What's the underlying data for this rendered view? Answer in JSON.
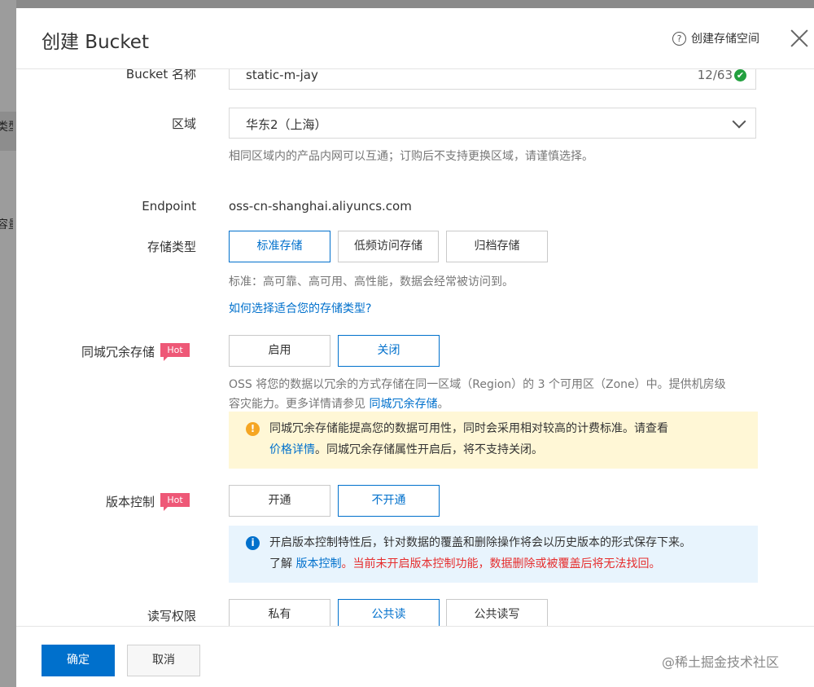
{
  "background": {
    "fragments": [
      "类型",
      "容量"
    ]
  },
  "dialog": {
    "title": "创建 Bucket",
    "help_label": "创建存储空间",
    "help_icon": "?",
    "close_icon": "close-icon"
  },
  "form": {
    "name": {
      "label": "Bucket 名称",
      "value": "static-m-jay",
      "count": "12/63",
      "valid_icon": "✔"
    },
    "region": {
      "label": "区域",
      "value": "华东2（上海）",
      "hint": "相同区域内的产品内网可以互通；订购后不支持更换区域，请谨慎选择。"
    },
    "endpoint": {
      "label": "Endpoint",
      "value": "oss-cn-shanghai.aliyuncs.com"
    },
    "storage_type": {
      "label": "存储类型",
      "options": [
        "标准存储",
        "低频访问存储",
        "归档存储"
      ],
      "selected": "标准存储",
      "hint": "标准：高可靠、高可用、高性能，数据会经常被访问到。",
      "link": "如何选择适合您的存储类型?"
    },
    "zone_redundancy": {
      "label": "同城冗余存储",
      "badge": "Hot",
      "options": [
        "启用",
        "关闭"
      ],
      "selected": "关闭",
      "desc_line1": "OSS 将您的数据以冗余的方式存储在同一区域（Region）的 3 个可用区（Zone）中。提供机房级",
      "desc_line2": "容灾能力。更多详情请参见",
      "desc_link": "同城冗余存储",
      "desc_end": "。",
      "warning_icon": "!",
      "warning_line1": "同城冗余存储能提高您的数据可用性，同时会采用相对较高的计费标准。请查看",
      "warning_link": "价格详情",
      "warning_line2": "。同城冗余存储属性开启后，将不支持关闭。"
    },
    "versioning": {
      "label": "版本控制",
      "badge": "Hot",
      "options": [
        "开通",
        "不开通"
      ],
      "selected": "不开通",
      "info_icon": "i",
      "info_line1": "开启版本控制特性后，针对数据的覆盖和删除操作将会以历史版本的形式保存下来。",
      "info_prefix": "了解",
      "info_link": "版本控制",
      "info_warning": "。当前未开启版本控制功能，数据删除或被覆盖后将无法找回。"
    },
    "acl": {
      "label": "读写权限",
      "options": [
        "私有",
        "公共读",
        "公共读写"
      ],
      "selected": "公共读"
    }
  },
  "footer": {
    "confirm": "确定",
    "cancel": "取消",
    "watermark": "@稀土掘金技术社区"
  },
  "colors": {
    "accent": "#0070cc",
    "hot": "#ee5877",
    "warn_bg": "#fff7d6",
    "info_bg": "#e8f4fd",
    "danger": "#e62e2e"
  }
}
